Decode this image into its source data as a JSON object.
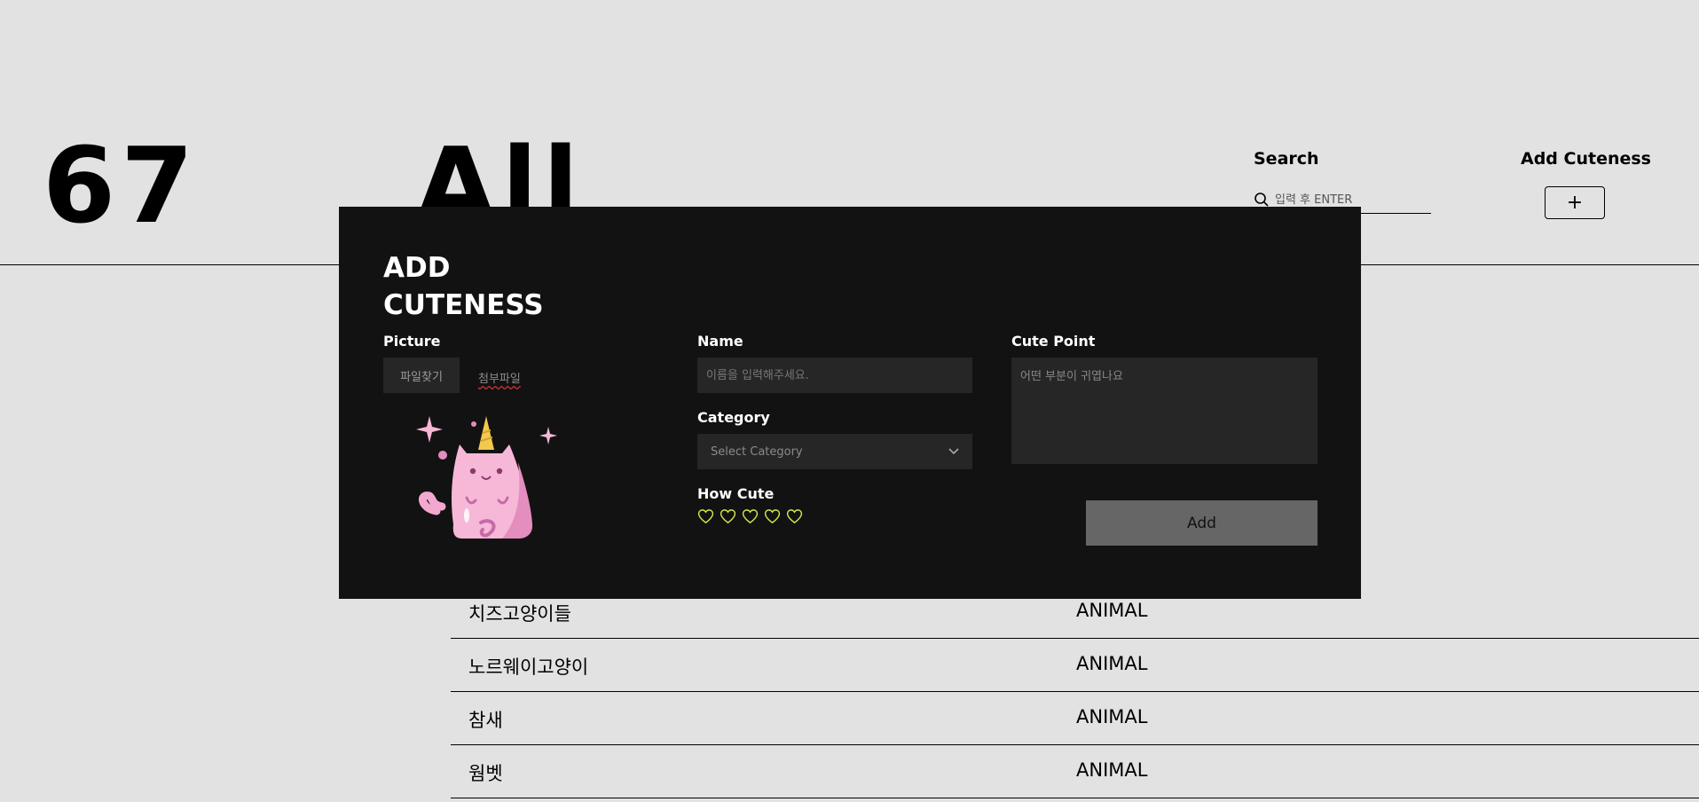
{
  "header": {
    "count": "67",
    "category_title": "All",
    "search": {
      "label": "Search",
      "placeholder": "입력 후 ENTER"
    },
    "add": {
      "label": "Add Cuteness",
      "button": "+"
    }
  },
  "list": {
    "rows": [
      {
        "name": "치즈고양이들",
        "category": "ANIMAL"
      },
      {
        "name": "노르웨이고양이",
        "category": "ANIMAL"
      },
      {
        "name": "참새",
        "category": "ANIMAL"
      },
      {
        "name": "웜벳",
        "category": "ANIMAL"
      }
    ]
  },
  "modal": {
    "title_line1": "ADD",
    "title_line2": "CUTENESS",
    "picture": {
      "label": "Picture",
      "button": "파일찾기",
      "file_name": "첨부파일"
    },
    "name": {
      "label": "Name",
      "placeholder": "이름을 입력해주세요."
    },
    "category": {
      "label": "Category",
      "selected": "Select Category"
    },
    "how_cute": {
      "label": "How Cute",
      "rating": 0,
      "max": 5
    },
    "cute_point": {
      "label": "Cute Point",
      "placeholder": "어떤 부분이 귀엽나요"
    },
    "submit": "Add"
  },
  "colors": {
    "background": "#e2e2e2",
    "modal": "#121212",
    "field": "#262626",
    "heart_outline": "#d6e84a",
    "submit": "#666666"
  }
}
